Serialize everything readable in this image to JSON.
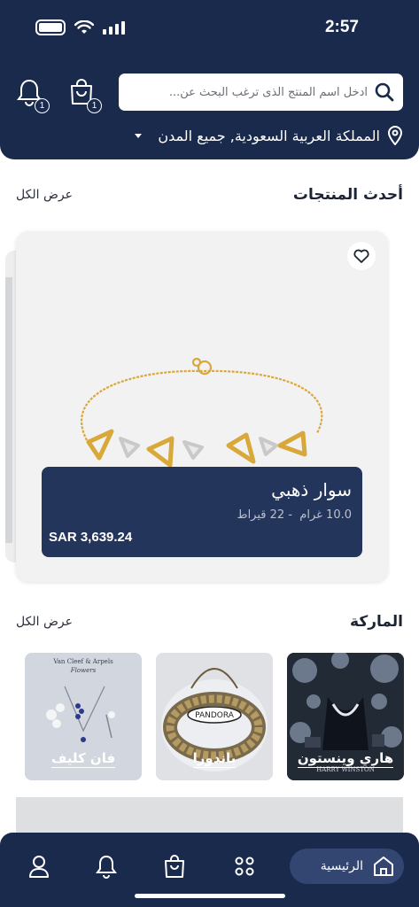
{
  "status_bar": {
    "time": "2:57"
  },
  "search": {
    "placeholder": "ادخل اسم المنتج الذى ترغب البحث عن..."
  },
  "header": {
    "notifications_count": "1",
    "cart_count": "1",
    "location": "المملكة العربية السعودية, جميع المدن"
  },
  "latest": {
    "title": "أحدث المنتجات",
    "view_all": "عرض الكل",
    "product": {
      "name": "سوار ذهبي",
      "weight": "10.0 غرام",
      "karat": "22 قيراط",
      "price": "SAR 3,639.24"
    }
  },
  "brands": {
    "title": "الماركة",
    "view_all": "عرض الكل",
    "items": [
      {
        "name": "هاري وينستون",
        "logo_text": "HARRY WINSTON"
      },
      {
        "name": "باندورا",
        "logo_text": "PANDORA"
      },
      {
        "name": "فان كليف",
        "logo_text": "Van Cleef & Arpels",
        "logo_sub": "Flowers"
      }
    ]
  },
  "nav": {
    "home_label": "الرئيسية",
    "items": [
      "home-icon",
      "categories-icon",
      "cart-icon",
      "bell-icon",
      "user-icon"
    ]
  },
  "colors": {
    "primary": "#1a2a4d",
    "panel": "#24355c",
    "gold": "#d9a83a"
  }
}
